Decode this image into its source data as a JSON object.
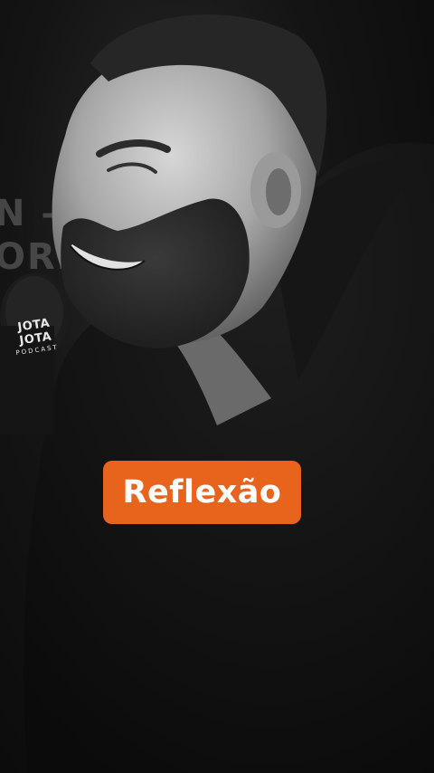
{
  "video": {
    "background_text": [
      "N —",
      "ORI"
    ],
    "podcast_logo": {
      "brand": "JOTA JOTA",
      "subtitle": "PODCAST"
    },
    "caption": "Reflexão",
    "colors": {
      "caption_background": "#e8641c",
      "caption_text": "#ffffff"
    }
  }
}
